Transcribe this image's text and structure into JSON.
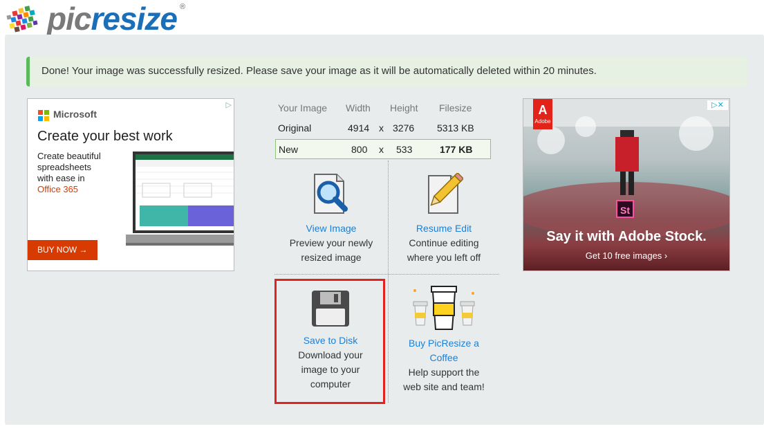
{
  "logo": {
    "pic": "pic",
    "resize": "resize",
    "registered": "®"
  },
  "alert": {
    "message": "Done! Your image was successfully resized. Please save your image as it will be automatically deleted within 20 minutes."
  },
  "ad_left": {
    "choice_icon": "ad-choices-icon",
    "brand": "Microsoft",
    "headline": "Create your best work",
    "body_lines": [
      "Create beautiful",
      "spreadsheets",
      "with ease in"
    ],
    "highlight": "Office 365",
    "button": "BUY NOW →"
  },
  "ad_right": {
    "badge": "Adobe",
    "close": "▷✕",
    "product_icon": "St",
    "headline": "Say it with Adobe Stock.",
    "subline": "Get 10 free images ›"
  },
  "table": {
    "headers": [
      "Your Image",
      "Width",
      "Height",
      "Filesize"
    ],
    "original": {
      "label": "Original",
      "width": "4914",
      "x": "x",
      "height": "3276",
      "size": "5313 KB"
    },
    "new": {
      "label": "New",
      "width": "800",
      "x": "x",
      "height": "533",
      "size": "177 KB"
    }
  },
  "actions": {
    "view": {
      "link": "View Image",
      "desc1": "Preview your newly",
      "desc2": "resized image"
    },
    "resume": {
      "link": "Resume Edit",
      "desc1": "Continue editing",
      "desc2": "where you left off"
    },
    "save": {
      "link": "Save to Disk",
      "desc1": "Download your",
      "desc2": "image to your",
      "desc3": "computer"
    },
    "coffee": {
      "link1": "Buy PicResize a",
      "link2": "Coffee",
      "desc1": "Help support the",
      "desc2": "web site and team!"
    }
  },
  "colors": {
    "accent_blue": "#1a7fd6",
    "success_green": "#5cb85c",
    "highlight_red": "#e0231e",
    "ms_orange": "#d83b01",
    "adobe_red": "#e2231a"
  }
}
